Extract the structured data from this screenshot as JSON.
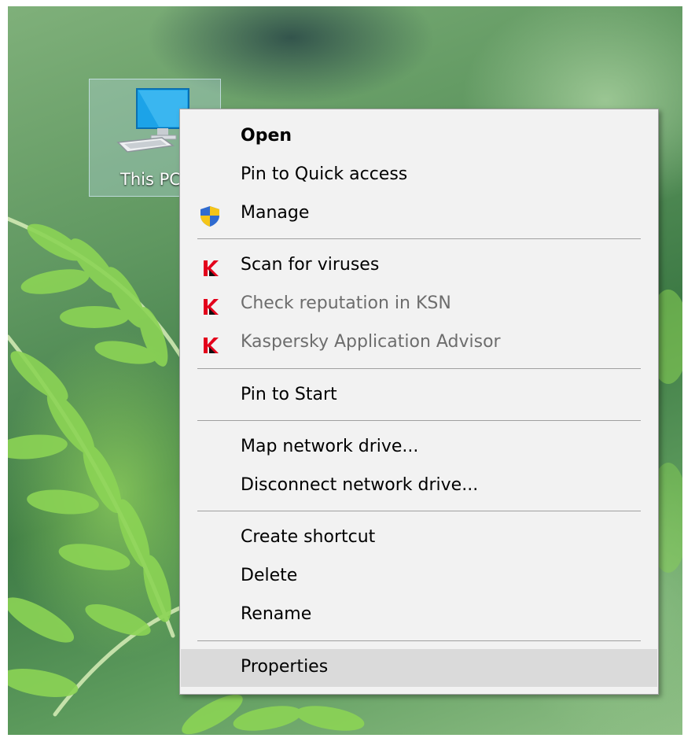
{
  "desktop": {
    "icon": {
      "label": "This PC",
      "icon": "computer-icon"
    }
  },
  "context_menu": {
    "groups": [
      {
        "items": [
          {
            "label": "Open",
            "bold": true
          },
          {
            "label": "Pin to Quick access"
          },
          {
            "label": "Manage",
            "icon": "uac-shield-icon"
          }
        ]
      },
      {
        "items": [
          {
            "label": "Scan for viruses",
            "icon": "kaspersky-icon"
          },
          {
            "label": "Check reputation in KSN",
            "icon": "kaspersky-icon",
            "disabled": true
          },
          {
            "label": "Kaspersky Application Advisor",
            "icon": "kaspersky-icon",
            "disabled": true
          }
        ]
      },
      {
        "items": [
          {
            "label": "Pin to Start"
          }
        ]
      },
      {
        "items": [
          {
            "label": "Map network drive..."
          },
          {
            "label": "Disconnect network drive..."
          }
        ]
      },
      {
        "items": [
          {
            "label": "Create shortcut"
          },
          {
            "label": "Delete"
          },
          {
            "label": "Rename"
          }
        ]
      },
      {
        "items": [
          {
            "label": "Properties",
            "highlighted": true
          }
        ]
      }
    ]
  },
  "colors": {
    "menu_bg": "#f2f2f2",
    "highlight": "#dadada",
    "separator": "#a0a0a0",
    "disabled_text": "#6d6d6d",
    "kaspersky_red": "#e3001b"
  }
}
